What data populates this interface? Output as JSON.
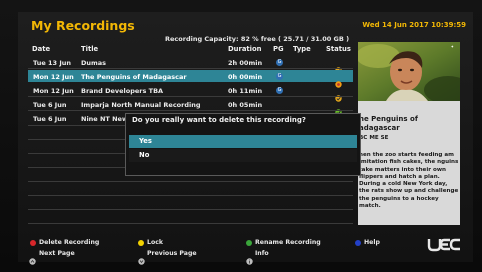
{
  "header": {
    "title": "My Recordings",
    "datetime": "Wed 14 Jun 2017 10:39:59",
    "capacity": "Recording Capacity:  82 % free ( 25.71 / 31.00 GB )"
  },
  "columns": [
    "Date",
    "Title",
    "Duration",
    "PG",
    "Type",
    "Status"
  ],
  "rows": [
    {
      "date": "Tue 13 Jun",
      "title": "Dumas",
      "duration": "2h 00min",
      "pg": "G",
      "status": "ok"
    },
    {
      "date": "Mon 12 Jun",
      "title": "The Penguins of Madagascar",
      "duration": "0h 00min",
      "pg": "G",
      "status": "recording"
    },
    {
      "date": "Mon 12 Jun",
      "title": "Brand Developers TBA",
      "duration": "0h 11min",
      "pg": "G",
      "status": "ok"
    },
    {
      "date": "Tue 6 Jun",
      "title": "Imparja North Manual Recording",
      "duration": "0h 05min",
      "pg": "",
      "status": "ok"
    },
    {
      "date": "Tue 6 Jun",
      "title": "Nine NT New",
      "duration": "",
      "pg": "",
      "status": ""
    }
  ],
  "details": {
    "program_title": "he Penguins of adagascar",
    "program_sub": "BC ME SE",
    "description": "hen the zoo starts feeding am imitation fish cakes, the nguins take matters into their own flippers and hatch a plan. During a cold New York day, the rats show up and challenge the penguins to a hockey match."
  },
  "dialog": {
    "question": "Do you really want to delete this recording?",
    "yes": "Yes",
    "no": "No"
  },
  "footer": {
    "delete": "Delete Recording",
    "lock": "Lock",
    "rename": "Rename Recording",
    "help": "Help",
    "next": "Next Page",
    "previous": "Previous Page",
    "info": "Info",
    "logo": "UEC"
  },
  "colors": {
    "accent": "#f2b705",
    "selected_row": "#2e8596",
    "red": "#d8262a",
    "yellow": "#f2d100",
    "green": "#3aa63a",
    "blue": "#2340c8"
  }
}
